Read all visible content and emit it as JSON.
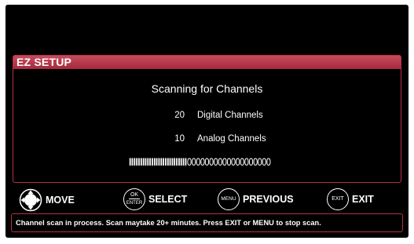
{
  "panel": {
    "title": "EZ SETUP",
    "scan_title": "Scanning for Channels",
    "digital": {
      "count": "20",
      "label": "Digital Channels"
    },
    "analog": {
      "count": "10",
      "label": "Analog Channels"
    },
    "progress": {
      "filled_text": "IIIIIIIIIIIIIIIIIIIIIIIIII",
      "empty_text": "0000000000000000000",
      "fraction": 0.58
    }
  },
  "legend": {
    "move": {
      "icon": "dpad-icon",
      "label": "MOVE"
    },
    "select": {
      "icon_top": "OK",
      "icon_bottom": "ENTER",
      "label": "SELECT"
    },
    "previous": {
      "icon_text": "MENU",
      "label": "PREVIOUS"
    },
    "exit": {
      "icon_text": "EXIT",
      "label": "EXIT"
    }
  },
  "status": {
    "text": "Channel scan in process. Scan maytake 20+ minutes. Press EXIT or MENU to stop scan."
  },
  "colors": {
    "background": "#000000",
    "accent": "#b72f45",
    "header": "#c0384c",
    "text": "#ffffff"
  }
}
